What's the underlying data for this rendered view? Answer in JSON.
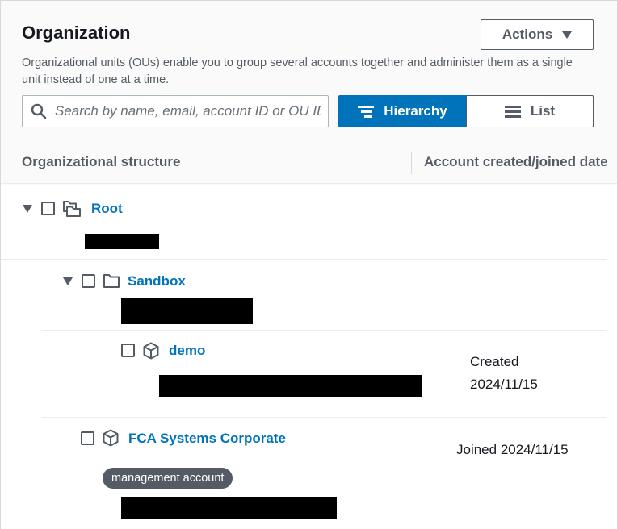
{
  "organization": {
    "title": "Organization",
    "actions_label": "Actions",
    "description": "Organizational units (OUs) enable you to group several accounts together and administer them as a single unit instead of one at a time.",
    "search": {
      "placeholder": "Search by name, email, account ID or OU ID"
    },
    "view_toggle": {
      "hierarchy_label": "Hierarchy",
      "list_label": "List",
      "selected": "Hierarchy"
    },
    "columns": {
      "structure": "Organizational structure",
      "date": "Account created/joined date"
    },
    "tree": {
      "root": {
        "name": "Root",
        "expanded": true
      },
      "sandbox": {
        "name": "Sandbox",
        "expanded": true
      },
      "demo": {
        "name": "demo",
        "date_prefix": "Created",
        "date": "2024/11/15"
      },
      "corporate": {
        "name": "FCA Systems Corporate",
        "date": "Joined 2024/11/15",
        "badge": "management account"
      }
    }
  },
  "colors": {
    "link": "#0073bb",
    "accent": "#0073bb",
    "badge_bg": "#545b64"
  }
}
